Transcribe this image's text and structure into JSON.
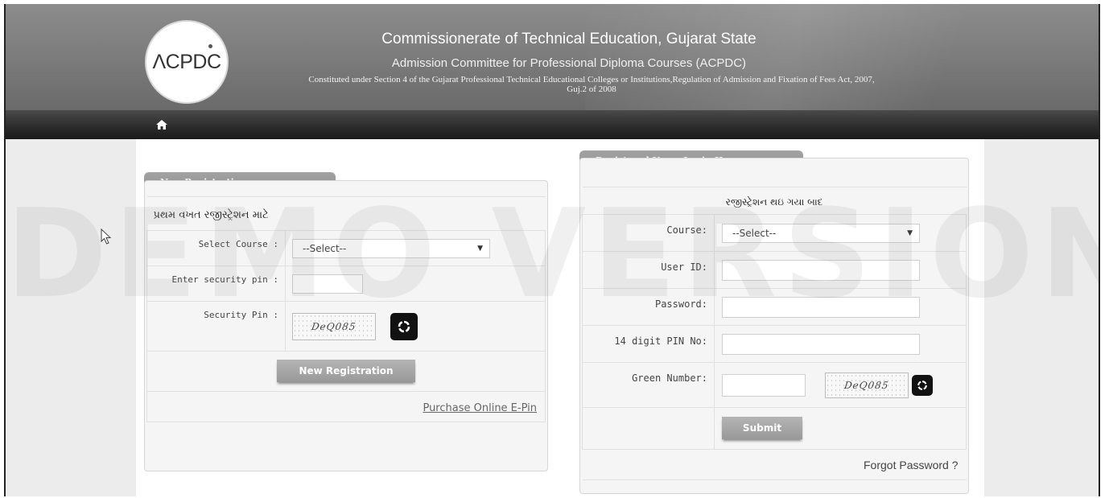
{
  "header": {
    "logo_text": "ΛCPDC",
    "title": "Commissionerate of Technical Education, Gujarat State",
    "subtitle": "Admission Committee for Professional Diploma Courses (ACPDC)",
    "constitution_line1": "Constituted under Section 4 of the Gujarat Professional Technical Educational Colleges or Institutions,Regulation of Admission and Fixation of Fees Act, 2007,",
    "constitution_line2": "Guj.2 of 2008"
  },
  "nav": {
    "home_icon": "home-icon"
  },
  "watermark": "DEMO VERSION",
  "new_registration": {
    "tab_label": "New Registration",
    "heading": "પ્રથમ વખત રજીસ્ટ્રેશન માટે",
    "course_label": "Select Course :",
    "course_selected": "--Select--",
    "pin_label": "Enter security pin :",
    "pin_value": "",
    "security_pin_label": "Security Pin :",
    "captcha_text": "DeQ085",
    "button_label": "New Registration",
    "purchase_link": "Purchase Online E-Pin"
  },
  "login": {
    "tab_label": "Registered Users Login Here",
    "heading": "રજીસ્ટ્રેશન થઇ ગયા બાદ",
    "course_label": "Course:",
    "course_selected": "--Select--",
    "userid_label": "User ID:",
    "userid_value": "",
    "password_label": "Password:",
    "password_value": "",
    "pin14_label": "14 digit PIN No:",
    "pin14_value": "",
    "green_label": "Green Number:",
    "green_value": "",
    "captcha_text": "DeQ085",
    "submit_label": "Submit",
    "forgot_label": "Forgot Password ?"
  },
  "colors": {
    "header_bg": "#7a7a7a",
    "navbar_bg": "#2a2a2a",
    "tab_bg": "#999999",
    "page_bg": "#ececec"
  }
}
